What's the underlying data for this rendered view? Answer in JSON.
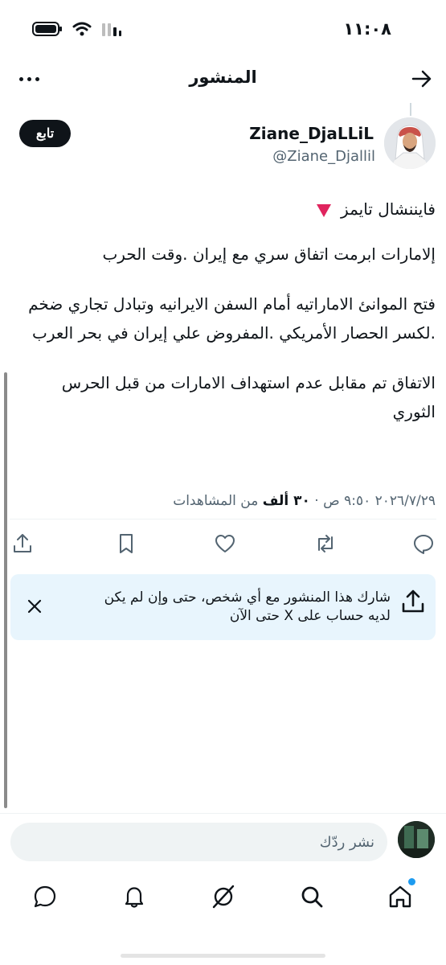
{
  "status_bar": {
    "time": "١١:٠٨",
    "icons": [
      "battery-icon",
      "wifi-icon",
      "signal-icon"
    ]
  },
  "header": {
    "title": "المنشور",
    "back_icon": "arrow-right-icon",
    "more_icon": "more-horizontal-icon"
  },
  "author": {
    "name": "Ziane_DjaLLiL",
    "handle": "@Ziane_Djallil",
    "follow_label": "تابع"
  },
  "post": {
    "lines": [
      "فايننشال تايمز",
      "إلامارات ابرمت اتفاق سري  مع إيران .وقت الحرب",
      "فتح الموانئ الاماراتيه أمام السفن الايرانيه  وتبادل تجاري ضخم .لكسر الحصار الأمريكي .المفروض علي إيران في بحر العرب",
      "الاتفاق تم مقابل عدم استهداف الامارات من قبل الحرس الثوري"
    ],
    "time": "٩:٥٠ ص",
    "date": "٢٠٢٦/٧/٢٩",
    "views_count": "٣٠ ألف",
    "views_label": "من المشاهدات"
  },
  "actions": [
    "reply-icon",
    "repost-icon",
    "like-icon",
    "bookmark-icon",
    "share-icon"
  ],
  "share_card": {
    "text": "شارك هذا المنشور مع أي شخص، حتى وإن لم يكن لديه حساب على X حتى الآن"
  },
  "reply": {
    "placeholder": "نشر ردّك"
  },
  "bottom_nav": [
    "home-icon",
    "search-icon",
    "grok-icon",
    "notifications-icon",
    "messages-icon"
  ],
  "colors": {
    "text": "#0f1419",
    "secondary": "#536471",
    "accent": "#1d9bf0",
    "share_bg": "#e8f5fd",
    "alert_red": "#e0245e"
  }
}
